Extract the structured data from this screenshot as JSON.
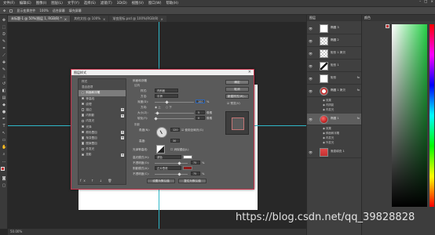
{
  "menubar": {
    "items": [
      "文件(F)",
      "编辑(E)",
      "图像(I)",
      "图层(L)",
      "文字(Y)",
      "选择(S)",
      "滤镜(T)",
      "3D(D)",
      "视图(V)",
      "窗口(W)",
      "帮助(H)"
    ]
  },
  "optbar": {
    "sample_label": "显示变换控件",
    "zoom_value": "100%",
    "fit_label": "适合屏幕",
    "fill_label": "填充屏幕"
  },
  "tabs": [
    {
      "label": "未标题-1 @ 50%(图层 1, RGB/8) *"
    },
    {
      "label": "其他文档 @ 100%"
    },
    {
      "label": "渐变图标.psd @ 100%(RGB/8)"
    }
  ],
  "status": {
    "text": "50.00%"
  },
  "dialog": {
    "title": "图层样式",
    "close": "×",
    "styles_header": "样式",
    "options_header": "混合选项",
    "style_items": [
      {
        "label": "斜面和浮雕",
        "on": true,
        "sel": true,
        "plus": false
      },
      {
        "label": "等高线",
        "on": false,
        "sel": false,
        "plus": false
      },
      {
        "label": "纹理",
        "on": false,
        "sel": false,
        "plus": false
      },
      {
        "label": "描边",
        "on": true,
        "sel": false,
        "plus": true
      },
      {
        "label": "内阴影",
        "on": false,
        "sel": false,
        "plus": true
      },
      {
        "label": "内发光",
        "on": true,
        "sel": false,
        "plus": false
      },
      {
        "label": "光泽",
        "on": false,
        "sel": false,
        "plus": false
      },
      {
        "label": "颜色叠加",
        "on": false,
        "sel": false,
        "plus": true
      },
      {
        "label": "渐变叠加",
        "on": false,
        "sel": false,
        "plus": true
      },
      {
        "label": "图案叠加",
        "on": false,
        "sel": false,
        "plus": false
      },
      {
        "label": "外发光",
        "on": true,
        "sel": false,
        "plus": false
      },
      {
        "label": "投影",
        "on": false,
        "sel": false,
        "plus": true
      }
    ],
    "list_footer": "fx ↑ ↓ 🗑",
    "section_title": "斜面和浮雕",
    "structure_label": "结构",
    "style_label": "样式:",
    "style_value": "内斜面",
    "technique_label": "方法:",
    "technique_value": "平滑",
    "depth_label": "深度(D):",
    "depth_value": "100",
    "direction_label": "方向:",
    "dir_up": "上",
    "dir_down": "下",
    "size_label": "大小(Z):",
    "size_value": "5",
    "soften_label": "软化(F):",
    "soften_value": "0",
    "px": "像素",
    "pct": "%",
    "shading_label": "阴影",
    "angle_label": "角度(N):",
    "angle_value": "120",
    "global_light": "使用全局光(G)",
    "altitude_label": "高度:",
    "altitude_value": "30",
    "gloss_label": "光泽等高线:",
    "antialias": "消除锯齿(L)",
    "hl_mode_label": "高光模式(H):",
    "hl_mode_value": "滤色",
    "hl_opacity_label": "不透明度(O):",
    "hl_opacity_value": "75",
    "sh_mode_label": "阴影模式(A):",
    "sh_mode_value": "正片叠底",
    "sh_opacity_label": "不透明度(C):",
    "sh_opacity_value": "75",
    "make_default": "设置为默认值",
    "reset_default": "复位为默认值",
    "ok": "确定",
    "cancel": "取消",
    "new_style": "新建样式(W)...",
    "preview_label": "预览(V)",
    "shadow_color": "#8e1a1a"
  },
  "layers": {
    "header": "图层",
    "rows": [
      {
        "name": "椭圆 3",
        "fx": "",
        "thumb": "white"
      },
      {
        "name": "椭圆 2",
        "fx": "",
        "thumb": "checker"
      },
      {
        "name": "矩形 1 拷贝",
        "fx": "",
        "thumb": "checker"
      },
      {
        "name": "矩形 1",
        "fx": "",
        "thumb": "stroke"
      },
      {
        "name": "矩形",
        "fx": "fx",
        "thumb": "white"
      },
      {
        "name": "椭圆 1 拷贝",
        "fx": "fx",
        "thumb": "ring"
      },
      {
        "name": "椭圆 1",
        "fx": "fx",
        "thumb": "red",
        "sel": true
      },
      {
        "name": "渐变填充 1",
        "fx": "",
        "thumb": "gradient"
      }
    ],
    "effects_a": [
      "效果",
      "内阴影",
      "内发光"
    ],
    "effects_b": [
      "效果",
      "斜面和浮雕",
      "内发光",
      "外发光"
    ]
  },
  "color": {
    "header": "颜色",
    "fg": "#c23131",
    "bg": "#ffffff",
    "hue_accent": "#26d147"
  },
  "watermark": "https://blog.csdn.net/qq_39828828"
}
